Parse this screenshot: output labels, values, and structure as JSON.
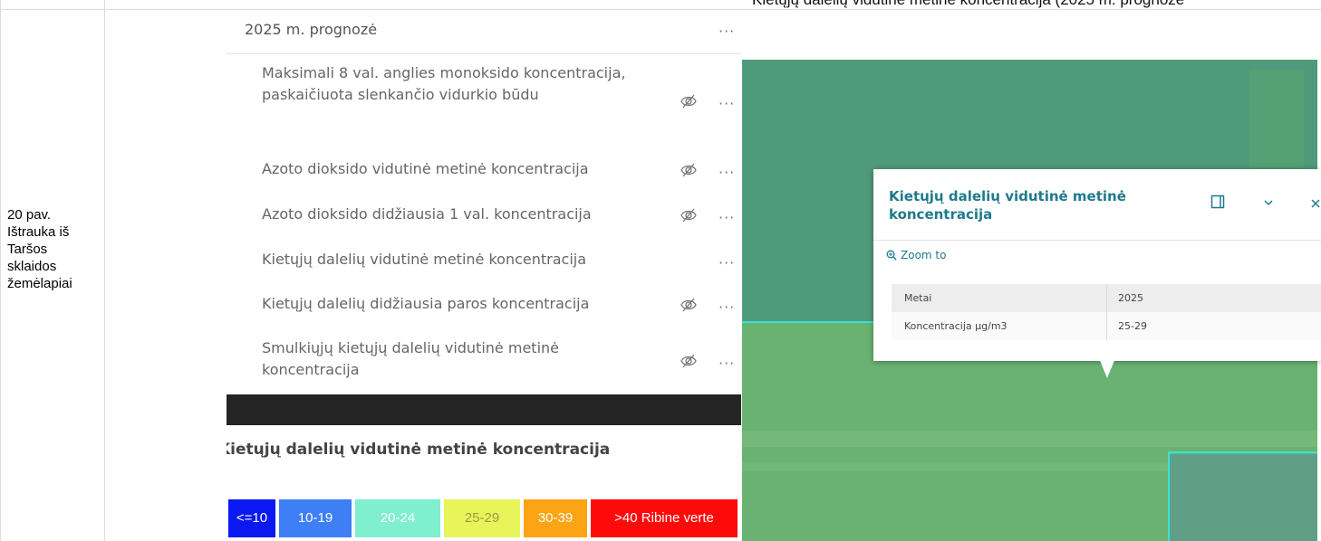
{
  "page": {
    "top_caption": "Kietųjų dalelių vidutinė metinė koncentracija (2025 m. prognozė",
    "figure_caption": "20 pav. Ištrauka iš Taršos sklaidos žemėlapiai"
  },
  "layer_list": {
    "group_title": "2025 m. prognozė",
    "group_menu": "···",
    "items": [
      {
        "label": "Maksimali 8 val. anglies monoksido koncentracija, paskaičiuota slenkančio vidurkio būdu",
        "hidden": true,
        "menu": "···"
      },
      {
        "label": "Azoto dioksido vidutinė metinė koncentracija",
        "hidden": true,
        "menu": "···"
      },
      {
        "label": "Azoto dioksido didžiausia 1 val. koncentracija",
        "hidden": true,
        "menu": "···"
      },
      {
        "label": "Kietųjų dalelių vidutinė metinė koncentracija",
        "hidden": false,
        "menu": "···"
      },
      {
        "label": "Kietųjų dalelių didžiausia paros koncentracija",
        "hidden": true,
        "menu": "···"
      },
      {
        "label": "Smulkiųjų kietųjų dalelių vidutinė metinė koncentracija",
        "hidden": true,
        "menu": "···"
      }
    ]
  },
  "legend": {
    "title": "Kietųjų dalelių vidutinė metinė koncentracija",
    "classes": [
      {
        "label": "<=10",
        "color": "#0a19f2",
        "text_color": "#ffffff"
      },
      {
        "label": "10-19",
        "color": "#3f7ff5",
        "text_color": "#ffffff"
      },
      {
        "label": "20-24",
        "color": "#7fefcf",
        "text_color": "#ffffff"
      },
      {
        "label": "25-29",
        "color": "#e8f55a",
        "text_color": "#9a9a40"
      },
      {
        "label": "30-39",
        "color": "#fca414",
        "text_color": "#ffffff"
      },
      {
        "label": ">40 Ribine verte",
        "color": "#ff0a0a",
        "text_color": "#ffffff"
      }
    ]
  },
  "popup": {
    "title": "Kietųjų dalelių vidutinė metinė koncentracija",
    "zoom_to": "Zoom to",
    "rows": [
      {
        "key": "Metai",
        "value": "2025"
      },
      {
        "key": "Koncentracija µg/m3",
        "value": "25-29"
      }
    ],
    "colors": {
      "accent": "#1f7a8c"
    }
  },
  "map": {
    "colors": {
      "upper_area": "#4f9a7a",
      "lower_area": "#69b271",
      "boundary": "#39e3d7"
    }
  }
}
